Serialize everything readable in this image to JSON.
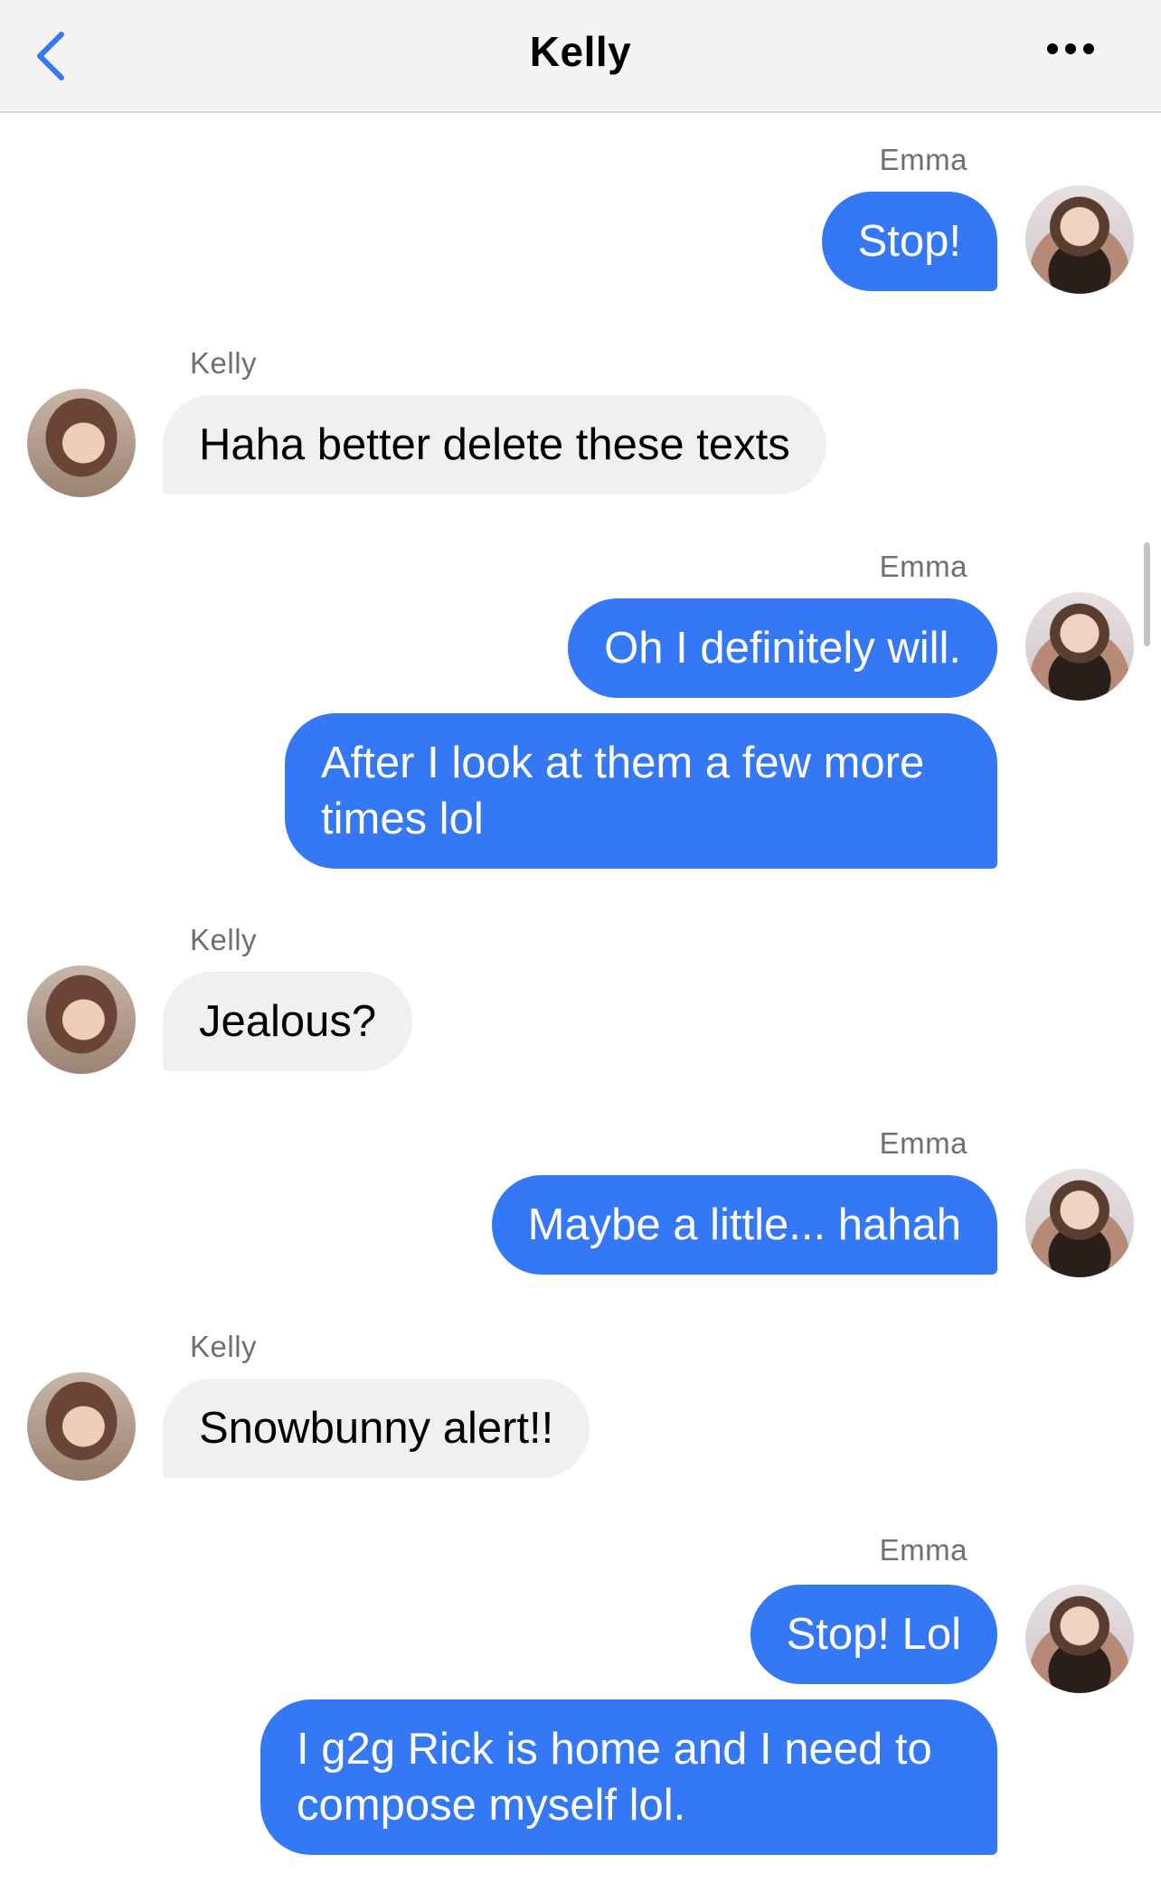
{
  "header": {
    "title": "Kelly",
    "back_icon": "chevron-left-icon",
    "more_icon": "ellipsis-icon",
    "accent_color": "#3478f6"
  },
  "messages": [
    {
      "sender": "Emma",
      "direction": "outgoing",
      "bubbles": [
        "Stop!"
      ]
    },
    {
      "sender": "Kelly",
      "direction": "incoming",
      "bubbles": [
        "Haha better delete these texts"
      ]
    },
    {
      "sender": "Emma",
      "direction": "outgoing",
      "bubbles": [
        "Oh I definitely will.",
        "After I look at them a few more\ntimes lol"
      ]
    },
    {
      "sender": "Kelly",
      "direction": "incoming",
      "bubbles": [
        "Jealous?"
      ]
    },
    {
      "sender": "Emma",
      "direction": "outgoing",
      "bubbles": [
        "Maybe a little... hahah"
      ]
    },
    {
      "sender": "Kelly",
      "direction": "incoming",
      "bubbles": [
        "Snowbunny alert!!"
      ]
    },
    {
      "sender": "Emma",
      "direction": "outgoing",
      "bubbles": [
        "Stop! Lol",
        "I g2g Rick is home and I need to\ncompose myself lol."
      ]
    }
  ],
  "colors": {
    "outgoing_bubble": "#3478f6",
    "incoming_bubble": "#f0f0f3",
    "sender_label": "#6e6e73"
  }
}
